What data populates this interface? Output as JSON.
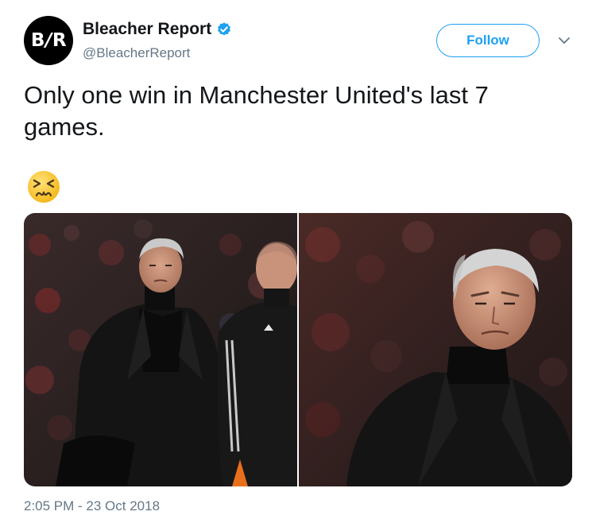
{
  "author": {
    "avatar_text_left": "B",
    "avatar_text_slash": "/",
    "avatar_text_right": "R",
    "display_name": "Bleacher Report",
    "handle": "@BleacherReport",
    "verified": true
  },
  "actions": {
    "follow_label": "Follow",
    "menu_icon": "chevron-down-icon"
  },
  "tweet": {
    "text": "Only one win in Manchester United's last 7 games.",
    "emoji": "persevering-face-emoji",
    "timestamp": "2:05 PM - 23 Oct 2018"
  },
  "media": {
    "photos": [
      {
        "description_icon": "photo-icon"
      },
      {
        "description_icon": "photo-icon"
      }
    ]
  },
  "colors": {
    "accent": "#1da1f2",
    "text": "#14171a",
    "secondary": "#657786"
  }
}
